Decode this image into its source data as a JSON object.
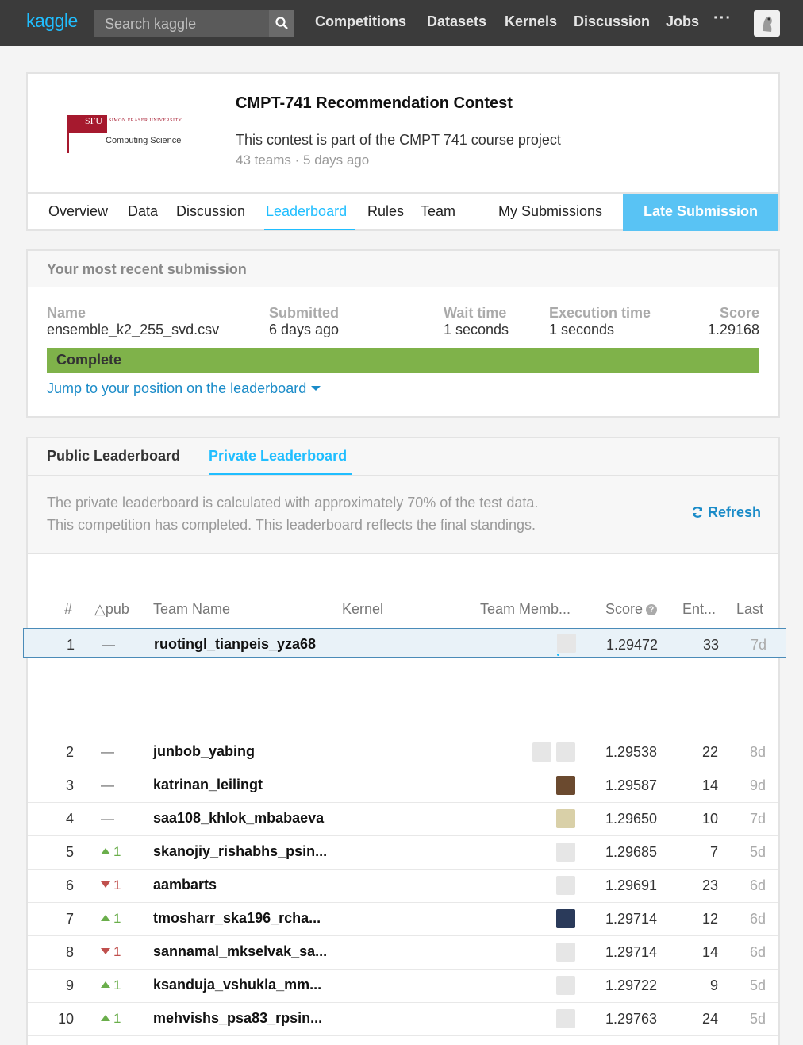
{
  "nav": {
    "logo": "kaggle",
    "search_placeholder": "Search kaggle",
    "links": [
      "Competitions",
      "Datasets",
      "Kernels",
      "Discussion",
      "Jobs"
    ],
    "more": "···"
  },
  "contest": {
    "logo_abbr": "SFU",
    "logo_name": "SIMON FRASER UNIVERSITY",
    "logo_dept": "Computing Science",
    "title": "CMPT-741 Recommendation Contest",
    "description": "This contest is part of the CMPT 741 course project",
    "meta": "43 teams · 5 days ago",
    "tabs": [
      "Overview",
      "Data",
      "Discussion",
      "Leaderboard",
      "Rules",
      "Team",
      "My Submissions"
    ],
    "active_tab": "Leaderboard",
    "late_submission": "Late Submission"
  },
  "recent": {
    "title": "Your most recent submission",
    "name_label": "Name",
    "name_value": "ensemble_k2_255_svd.csv",
    "submitted_label": "Submitted",
    "submitted_value": "6 days ago",
    "wait_label": "Wait time",
    "wait_value": "1 seconds",
    "exec_label": "Execution time",
    "exec_value": "1 seconds",
    "score_label": "Score",
    "score_value": "1.29168",
    "status": "Complete",
    "status_color": "#7fb24a",
    "jump_link": "Jump to your position on the leaderboard"
  },
  "leaderboard": {
    "tab_public": "Public Leaderboard",
    "tab_private": "Private Leaderboard",
    "active_tab": "Private Leaderboard",
    "info_line1": "The private leaderboard is calculated with approximately 70% of the test data.",
    "info_line2": "This competition has completed. This leaderboard reflects the final standings.",
    "refresh": "Refresh",
    "columns": {
      "rank": "#",
      "delta": "△pub",
      "team": "Team Name",
      "kernel": "Kernel",
      "members": "Team Memb...",
      "score": "Score",
      "entries": "Ent...",
      "last": "Last"
    },
    "my_row": {
      "rank": "1",
      "delta": "—",
      "team": "ruotingl_tianpeis_yza68",
      "score": "1.29472",
      "entries": "33",
      "last": "7d"
    },
    "rows": [
      {
        "rank": "2",
        "delta": "—",
        "team": "junbob_yabing",
        "score": "1.29538",
        "entries": "22",
        "last": "8d"
      },
      {
        "rank": "3",
        "delta": "—",
        "team": "katrinan_leilingt",
        "score": "1.29587",
        "entries": "14",
        "last": "9d"
      },
      {
        "rank": "4",
        "delta": "—",
        "team": "saa108_khlok_mbabaeva",
        "score": "1.29650",
        "entries": "10",
        "last": "7d"
      },
      {
        "rank": "5",
        "delta": "1",
        "team": "skanojiy_rishabhs_psin...",
        "score": "1.29685",
        "entries": "7",
        "last": "5d"
      },
      {
        "rank": "6",
        "delta": "1",
        "team": "aambarts",
        "score": "1.29691",
        "entries": "23",
        "last": "6d"
      },
      {
        "rank": "7",
        "delta": "1",
        "team": "tmosharr_ska196_rcha...",
        "score": "1.29714",
        "entries": "12",
        "last": "6d"
      },
      {
        "rank": "8",
        "delta": "1",
        "team": "sannamal_mkselvak_sa...",
        "score": "1.29714",
        "entries": "14",
        "last": "6d"
      },
      {
        "rank": "9",
        "delta": "1",
        "team": "ksanduja_vshukla_mm...",
        "score": "1.29722",
        "entries": "9",
        "last": "5d"
      },
      {
        "rank": "10",
        "delta": "1",
        "team": "mehvishs_psa83_rpsin...",
        "score": "1.29763",
        "entries": "24",
        "last": "5d"
      }
    ]
  }
}
